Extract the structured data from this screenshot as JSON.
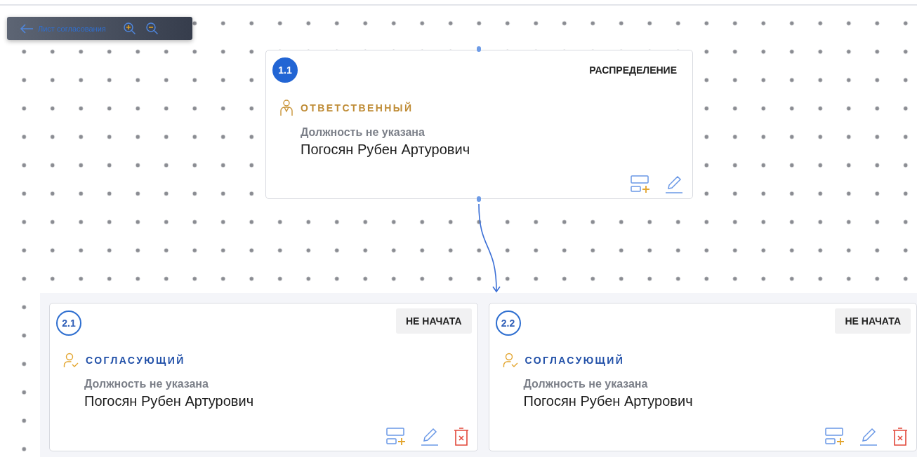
{
  "toolbar": {
    "back_label": "Лист согласования"
  },
  "top_node": {
    "number": "1.1",
    "current": true,
    "status": "РАСПРЕДЕЛЕНИЕ",
    "kind": "responsible",
    "role": "ОТВЕТСТВЕННЫЙ",
    "position": "Должность не указана",
    "name": "Погосян Рубен Артурович",
    "deletable": false
  },
  "group_nodes": [
    {
      "number": "2.1",
      "current": false,
      "status": "НЕ НАЧАТА",
      "kind": "approver",
      "role": "СОГЛАСУЮЩИЙ",
      "position": "Должность не указана",
      "name": "Погосян Рубен Артурович",
      "deletable": true
    },
    {
      "number": "2.2",
      "current": false,
      "status": "НЕ НАЧАТА",
      "kind": "approver",
      "role": "СОГЛАСУЮЩИЙ",
      "position": "Должность не указана",
      "name": "Погосян Рубен Артурович",
      "deletable": true
    }
  ]
}
